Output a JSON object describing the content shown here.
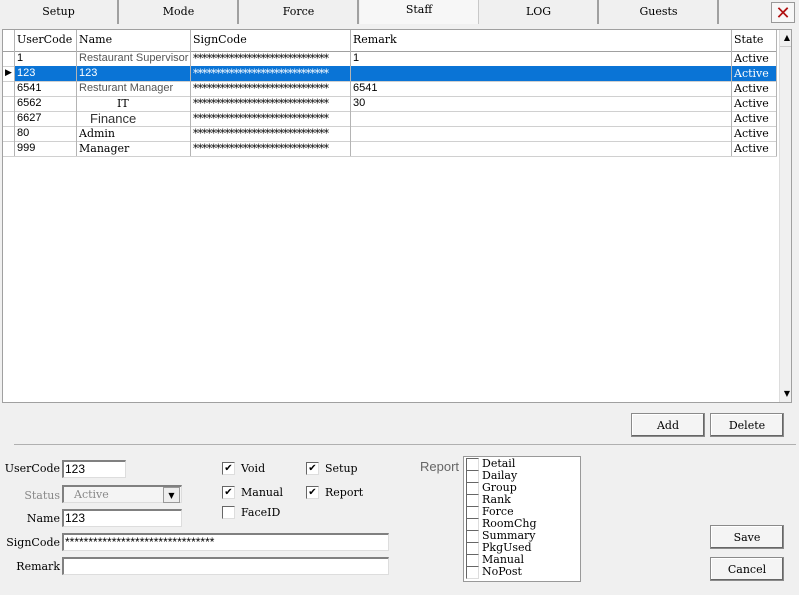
{
  "tabs": [
    {
      "label": "Setup"
    },
    {
      "label": "Mode"
    },
    {
      "label": "Force"
    },
    {
      "label": "Staff",
      "active": true
    },
    {
      "label": "LOG"
    },
    {
      "label": "Guests"
    }
  ],
  "close_icon": "close-icon",
  "grid": {
    "columns": [
      "UserCode",
      "Name",
      "SignCode",
      "Remark",
      "State"
    ],
    "selected_index": 1,
    "rows": [
      {
        "usercode": "1",
        "name": "Restaurant Supervisor",
        "signcode": "******************************",
        "remark": "1",
        "state": "Active"
      },
      {
        "usercode": "123",
        "name": "123",
        "signcode": "******************************",
        "remark": "",
        "state": "Active"
      },
      {
        "usercode": "6541",
        "name": "Resturant Manager",
        "signcode": "******************************",
        "remark": "6541",
        "state": "Active"
      },
      {
        "usercode": "6562",
        "name": "IT",
        "signcode": "******************************",
        "remark": "30",
        "state": "Active"
      },
      {
        "usercode": "6627",
        "name": "Finance",
        "signcode": "******************************",
        "remark": "",
        "state": "Active"
      },
      {
        "usercode": "80",
        "name": "Admin",
        "signcode": "******************************",
        "remark": "",
        "state": "Active"
      },
      {
        "usercode": "999",
        "name": "Manager",
        "signcode": "******************************",
        "remark": "",
        "state": "Active"
      }
    ]
  },
  "buttons": {
    "add": "Add",
    "delete": "Delete",
    "save": "Save",
    "cancel": "Cancel"
  },
  "form": {
    "usercode_label": "UserCode",
    "usercode": "123",
    "status_label": "Status",
    "status": "Active",
    "name_label": "Name",
    "name": "123",
    "signcode_label": "SignCode",
    "signcode": "********************************",
    "remark_label": "Remark",
    "remark": "",
    "checks": [
      {
        "label": "Void",
        "checked": true
      },
      {
        "label": "Setup",
        "checked": true
      },
      {
        "label": "Manual",
        "checked": true
      },
      {
        "label": "Report",
        "checked": true
      },
      {
        "label": "FaceID",
        "checked": false
      }
    ],
    "report_label": "Report",
    "reports": [
      {
        "label": "Detail",
        "checked": false
      },
      {
        "label": "Dailay",
        "checked": false
      },
      {
        "label": "Group",
        "checked": false
      },
      {
        "label": "Rank",
        "checked": false
      },
      {
        "label": "Force",
        "checked": false
      },
      {
        "label": "RoomChg",
        "checked": false
      },
      {
        "label": "Summary",
        "checked": false
      },
      {
        "label": "PkgUsed",
        "checked": false
      },
      {
        "label": "Manual",
        "checked": false
      },
      {
        "label": "NoPost",
        "checked": false
      }
    ]
  }
}
